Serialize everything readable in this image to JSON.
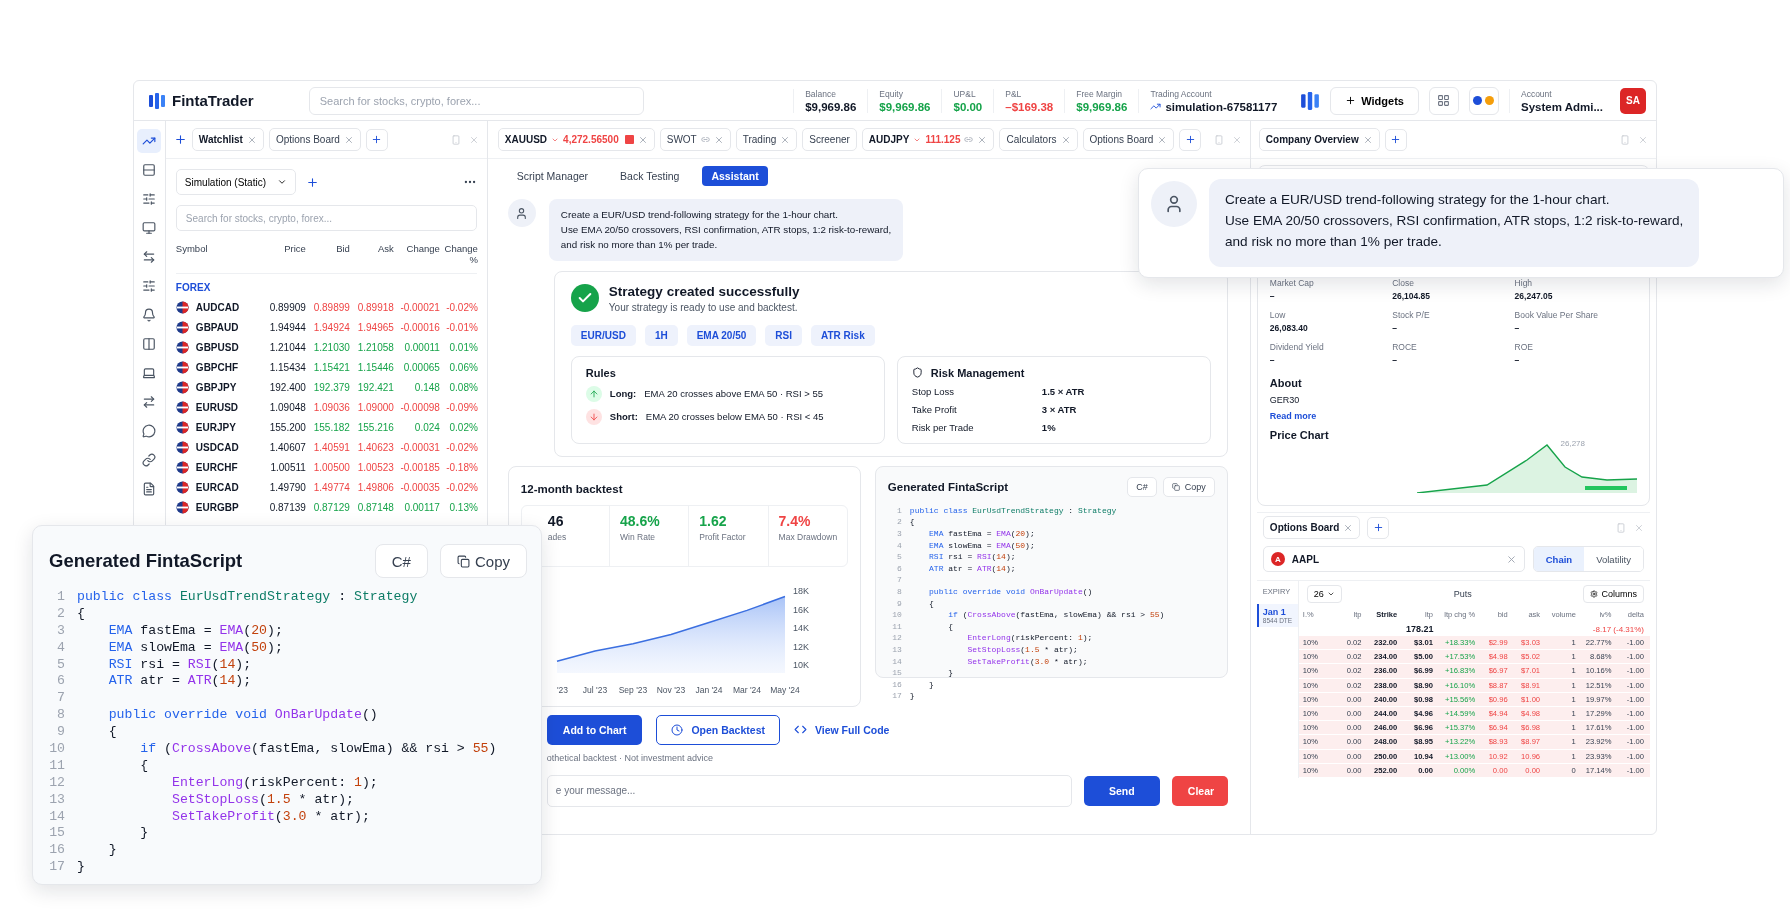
{
  "topbar": {
    "logo": "FintaTrader",
    "search": {
      "placeholder": "Search for stocks, crypto, forex..."
    },
    "stats": [
      {
        "label": "Balance",
        "value": "$9,969.86",
        "kind": "plain"
      },
      {
        "label": "Equity",
        "value": "$9,969.86",
        "kind": "gain"
      },
      {
        "label": "UP&L",
        "value": "$0.00",
        "kind": "gain"
      },
      {
        "label": "P&L",
        "value": "–$169.38",
        "kind": "loss"
      },
      {
        "label": "Free Margin",
        "value": "$9,969.86",
        "kind": "gain"
      }
    ],
    "account": {
      "label": "Trading Account",
      "value": "simulation-67581177"
    },
    "widgets_button": "Widgets",
    "user": {
      "label": "Account",
      "name": "System Admi...",
      "initials": "SA"
    }
  },
  "rail": [
    {
      "kind": "trend",
      "selected": true
    },
    {
      "kind": "rows",
      "selected": false
    },
    {
      "kind": "filters",
      "selected": false
    },
    {
      "kind": "monitor",
      "selected": false
    },
    {
      "kind": "transfer",
      "selected": false
    },
    {
      "kind": "sliders",
      "selected": false
    },
    {
      "kind": "bell",
      "selected": false
    },
    {
      "kind": "columns",
      "selected": false
    },
    {
      "kind": "laptop",
      "selected": false
    },
    {
      "kind": "swap",
      "selected": false
    },
    {
      "kind": "chat",
      "selected": false
    },
    {
      "kind": "link",
      "selected": false
    },
    {
      "kind": "document",
      "selected": false
    }
  ],
  "watchlist_panel": {
    "tabs": [
      {
        "label": "Watchlist",
        "selected": true
      },
      {
        "label": "Options Board",
        "selected": false
      }
    ],
    "list_select": "Simulation (Static)",
    "search": {
      "placeholder": "Search for stocks, crypto, forex..."
    },
    "columns": [
      "Symbol",
      "Price",
      "Bid",
      "Ask",
      "Change",
      "Change %"
    ],
    "group": "FOREX",
    "rows": [
      {
        "symbol": "AUDCAD",
        "price": "0.89909",
        "bid": "0.89899",
        "ask": "0.89918",
        "change": "-0.00021",
        "change_pct": "-0.02%",
        "up": false
      },
      {
        "symbol": "GBPAUD",
        "price": "1.94944",
        "bid": "1.94924",
        "ask": "1.94965",
        "change": "-0.00016",
        "change_pct": "-0.01%",
        "up": false
      },
      {
        "symbol": "GBPUSD",
        "price": "1.21044",
        "bid": "1.21030",
        "ask": "1.21058",
        "change": "0.00011",
        "change_pct": "0.01%",
        "up": true
      },
      {
        "symbol": "GBPCHF",
        "price": "1.15434",
        "bid": "1.15421",
        "ask": "1.15446",
        "change": "0.00065",
        "change_pct": "0.06%",
        "up": true
      },
      {
        "symbol": "GBPJPY",
        "price": "192.400",
        "bid": "192.379",
        "ask": "192.421",
        "change": "0.148",
        "change_pct": "0.08%",
        "up": true
      },
      {
        "symbol": "EURUSD",
        "price": "1.09048",
        "bid": "1.09036",
        "ask": "1.09000",
        "change": "-0.00098",
        "change_pct": "-0.09%",
        "up": false
      },
      {
        "symbol": "EURJPY",
        "price": "155.200",
        "bid": "155.182",
        "ask": "155.216",
        "change": "0.024",
        "change_pct": "0.02%",
        "up": true
      },
      {
        "symbol": "USDCAD",
        "price": "1.40607",
        "bid": "1.40591",
        "ask": "1.40623",
        "change": "-0.00031",
        "change_pct": "-0.02%",
        "up": false
      },
      {
        "symbol": "EURCHF",
        "price": "1.00511",
        "bid": "1.00500",
        "ask": "1.00523",
        "change": "-0.00185",
        "change_pct": "-0.18%",
        "up": false
      },
      {
        "symbol": "EURCAD",
        "price": "1.49790",
        "bid": "1.49774",
        "ask": "1.49806",
        "change": "-0.00035",
        "change_pct": "-0.02%",
        "up": false
      },
      {
        "symbol": "EURGBP",
        "price": "0.87139",
        "bid": "0.87129",
        "ask": "0.87148",
        "change": "0.00117",
        "change_pct": "0.13%",
        "up": true
      }
    ]
  },
  "workspace": {
    "tabs": [
      {
        "kind": "symbol",
        "label": "XAUUSD",
        "price": "4,272.56500",
        "closable": true
      },
      {
        "kind": "linked",
        "label": "SWOT",
        "closable": true
      },
      {
        "kind": "widget",
        "label": "Trading",
        "closable": true
      },
      {
        "kind": "widget",
        "label": "Screener",
        "closable": false
      },
      {
        "kind": "linkedsymbol",
        "label": "AUDJPY",
        "price": "111.125",
        "closable": true
      },
      {
        "kind": "widget",
        "label": "Calculators",
        "closable": true
      },
      {
        "kind": "widget",
        "label": "Options Board",
        "closable": true
      }
    ],
    "subtabs": [
      {
        "label": "Script Manager",
        "selected": false
      },
      {
        "label": "Back Testing",
        "selected": false
      },
      {
        "label": "Assistant",
        "selected": true
      }
    ],
    "message_lines": [
      "Create a EUR/USD trend-following strategy for the 1-hour chart.",
      "Use EMA 20/50 crossovers, RSI confirmation, ATR stops, 1:2 risk-to-reward,",
      "and risk no more than 1% per trade."
    ],
    "result": {
      "title": "Strategy created successfully",
      "subtitle": "Your strategy is ready to use and backtest.",
      "tags": [
        "EUR/USD",
        "1H",
        "EMA 20/50",
        "RSI",
        "ATR Risk"
      ],
      "rules_title": "Rules",
      "rules": [
        {
          "kind": "long",
          "label": "Long:",
          "text": "EMA 20 crosses above EMA 50 · RSI > 55"
        },
        {
          "kind": "short",
          "label": "Short:",
          "text": "EMA 20 crosses below EMA 50 · RSI < 45"
        }
      ],
      "risk_title": "Risk Management",
      "risk": [
        {
          "label": "Stop Loss",
          "value": "1.5 × ATR"
        },
        {
          "label": "Take Profit",
          "value": "3 × ATR"
        },
        {
          "label": "Risk per Trade",
          "value": "1%"
        }
      ]
    },
    "backtest": {
      "title": "12-month backtest",
      "stats": [
        {
          "value": "46",
          "label": "ades",
          "kind": "plain"
        },
        {
          "value": "48.6%",
          "label": "Win Rate",
          "kind": "gain"
        },
        {
          "value": "1.62",
          "label": "Profit Factor",
          "kind": "gain"
        },
        {
          "value": "7.4%",
          "label": "Max Drawdown",
          "kind": "loss"
        }
      ],
      "chart_data": {
        "type": "area",
        "categories": [
          "'23",
          "Jul '23",
          "Sep '23",
          "Nov '23",
          "Jan '24",
          "Mar '24",
          "May '24"
        ],
        "values": [
          10400,
          11500,
          12300,
          13300,
          14600,
          15900,
          17400
        ],
        "ylim": [
          10000,
          18000
        ],
        "yticks": [
          {
            "value": 10000,
            "label": "10K"
          },
          {
            "value": 12000,
            "label": "12K"
          },
          {
            "value": 14000,
            "label": "14K"
          },
          {
            "value": 16000,
            "label": "16K"
          },
          {
            "value": 18000,
            "label": "18K"
          }
        ]
      }
    },
    "script": {
      "title": "Generated FintaScript",
      "lang": "C#",
      "copy": "Copy",
      "lines": [
        {
          "n": "1",
          "t": [
            {
              "kind": "kw",
              "text": "public class "
            },
            {
              "kind": "type",
              "text": "EurUsdTrendStrategy"
            },
            {
              "kind": "p",
              "text": " : "
            },
            {
              "kind": "type",
              "text": "Strategy"
            }
          ]
        },
        {
          "n": "2",
          "t": [
            {
              "kind": "p",
              "text": "{"
            }
          ]
        },
        {
          "n": "3",
          "t": [
            {
              "kind": "kw",
              "text": "    EMA"
            },
            {
              "kind": "p",
              "text": " fastEma = "
            },
            {
              "kind": "fn",
              "text": "EMA"
            },
            {
              "kind": "p",
              "text": "("
            },
            {
              "kind": "num",
              "text": "20"
            },
            {
              "kind": "p",
              "text": ");"
            }
          ]
        },
        {
          "n": "4",
          "t": [
            {
              "kind": "kw",
              "text": "    EMA"
            },
            {
              "kind": "p",
              "text": " slowEma = "
            },
            {
              "kind": "fn",
              "text": "EMA"
            },
            {
              "kind": "p",
              "text": "("
            },
            {
              "kind": "num",
              "text": "50"
            },
            {
              "kind": "p",
              "text": ");"
            }
          ]
        },
        {
          "n": "5",
          "t": [
            {
              "kind": "kw",
              "text": "    RSI"
            },
            {
              "kind": "p",
              "text": " rsi = "
            },
            {
              "kind": "fn",
              "text": "RSI"
            },
            {
              "kind": "p",
              "text": "("
            },
            {
              "kind": "num",
              "text": "14"
            },
            {
              "kind": "p",
              "text": ");"
            }
          ]
        },
        {
          "n": "6",
          "t": [
            {
              "kind": "kw",
              "text": "    ATR"
            },
            {
              "kind": "p",
              "text": " atr = "
            },
            {
              "kind": "fn",
              "text": "ATR"
            },
            {
              "kind": "p",
              "text": "("
            },
            {
              "kind": "num",
              "text": "14"
            },
            {
              "kind": "p",
              "text": ");"
            }
          ]
        },
        {
          "n": "7"
        },
        {
          "n": "8",
          "t": [
            {
              "kind": "kw",
              "text": "    public override void "
            },
            {
              "kind": "fn",
              "text": "OnBarUpdate"
            },
            {
              "kind": "p",
              "text": "()"
            }
          ]
        },
        {
          "n": "9",
          "t": [
            {
              "kind": "p",
              "text": "    {"
            }
          ]
        },
        {
          "n": "10",
          "t": [
            {
              "kind": "kw",
              "text": "        if"
            },
            {
              "kind": "p",
              "text": " ("
            },
            {
              "kind": "fn",
              "text": "CrossAbove"
            },
            {
              "kind": "p",
              "text": "(fastEma, slowEma) && rsi > "
            },
            {
              "kind": "num",
              "text": "55"
            },
            {
              "kind": "p",
              "text": ")"
            }
          ]
        },
        {
          "n": "11",
          "t": [
            {
              "kind": "p",
              "text": "        {"
            }
          ]
        },
        {
          "n": "12",
          "t": [
            {
              "kind": "fn",
              "text": "            EnterLong"
            },
            {
              "kind": "p",
              "text": "(riskPercent: "
            },
            {
              "kind": "num",
              "text": "1"
            },
            {
              "kind": "p",
              "text": ");"
            }
          ]
        },
        {
          "n": "13",
          "t": [
            {
              "kind": "fn",
              "text": "            SetStopLoss"
            },
            {
              "kind": "p",
              "text": "("
            },
            {
              "kind": "num",
              "text": "1.5"
            },
            {
              "kind": "p",
              "text": " * atr);"
            }
          ]
        },
        {
          "n": "14",
          "t": [
            {
              "kind": "fn",
              "text": "            SetTakeProfit"
            },
            {
              "kind": "p",
              "text": "("
            },
            {
              "kind": "num",
              "text": "3.0"
            },
            {
              "kind": "p",
              "text": " * atr);"
            }
          ]
        },
        {
          "n": "15",
          "t": [
            {
              "kind": "p",
              "text": "        }"
            }
          ]
        },
        {
          "n": "16",
          "t": [
            {
              "kind": "p",
              "text": "    }"
            }
          ]
        },
        {
          "n": "17",
          "t": [
            {
              "kind": "p",
              "text": "}"
            }
          ]
        }
      ]
    },
    "actions": {
      "add": "Add to Chart",
      "open": "Open Backtest",
      "code": "View Full Code"
    },
    "disclaimer": "othetical backtest · Not investment advice",
    "composer": {
      "placeholder": "e your message...",
      "send": "Send",
      "clear": "Clear"
    }
  },
  "overview": {
    "tabs": [
      {
        "label": "Company Overview",
        "selected": true
      }
    ],
    "stats": [
      {
        "label": "Market Cap",
        "value": "–"
      },
      {
        "label": "Close",
        "value": "26,104.85"
      },
      {
        "label": "High",
        "value": "26,247.05"
      },
      {
        "label": "Low",
        "value": "26,083.40"
      },
      {
        "label": "Stock P/E",
        "value": "–"
      },
      {
        "label": "Book Value Per Share",
        "value": "–"
      },
      {
        "label": "Dividend Yield",
        "value": "–"
      },
      {
        "label": "ROCE",
        "value": "–"
      },
      {
        "label": "ROE",
        "value": "–"
      }
    ],
    "about_title": "About",
    "about_text": "GER30",
    "read_more": "Read more",
    "chart_title": "Price Chart",
    "chart_label": "26,278"
  },
  "options": {
    "tabs": [
      {
        "label": "Options Board",
        "selected": true
      }
    ],
    "symbol_badge": "A",
    "symbol": "AAPL",
    "views": [
      {
        "label": "Chain",
        "selected": true
      },
      {
        "label": "Volatility",
        "selected": false
      }
    ],
    "expiry_label": "EXPIRY",
    "expiries": [
      {
        "date": "Jan 1",
        "dte": "8544 DTE",
        "selected": true
      }
    ],
    "count_select": "26",
    "side": "Puts",
    "columns_button": "Columns",
    "columns": [
      "I.%",
      "ltp",
      "Strike",
      "ltp",
      "ltp chg %",
      "bid",
      "ask",
      "volume",
      "iv%",
      "delta"
    ],
    "spot": "178.21",
    "spot_change": "-8.17 (-4.31%)",
    "rows": [
      [
        "10%",
        "0.02",
        "232.00",
        "$3.01",
        "+18.33%",
        "$2.99",
        "$3.03",
        "1",
        "22.77%",
        "-1.00"
      ],
      [
        "10%",
        "0.02",
        "234.00",
        "$5.00",
        "+17.53%",
        "$4.98",
        "$5.02",
        "1",
        "8.68%",
        "-1.00"
      ],
      [
        "10%",
        "0.02",
        "236.00",
        "$6.99",
        "+16.83%",
        "$6.97",
        "$7.01",
        "1",
        "10.16%",
        "-1.00"
      ],
      [
        "10%",
        "0.02",
        "238.00",
        "$8.90",
        "+16.10%",
        "$8.87",
        "$8.91",
        "1",
        "12.51%",
        "-1.00"
      ],
      [
        "10%",
        "0.00",
        "240.00",
        "$0.98",
        "+15.56%",
        "$0.96",
        "$1.00",
        "1",
        "19.97%",
        "-1.00"
      ],
      [
        "10%",
        "0.00",
        "244.00",
        "$4.96",
        "+14.59%",
        "$4.94",
        "$4.98",
        "1",
        "17.29%",
        "-1.00"
      ],
      [
        "10%",
        "0.00",
        "246.00",
        "$6.96",
        "+15.37%",
        "$6.94",
        "$6.98",
        "1",
        "17.61%",
        "-1.00"
      ],
      [
        "10%",
        "0.00",
        "248.00",
        "$8.95",
        "+13.22%",
        "$8.93",
        "$8.97",
        "1",
        "23.92%",
        "-1.00"
      ],
      [
        "10%",
        "0.00",
        "250.00",
        "10.94",
        "+13.00%",
        "10.92",
        "10.96",
        "1",
        "23.93%",
        "-1.00"
      ],
      [
        "10%",
        "0.00",
        "252.00",
        "0.00",
        "0.00%",
        "0.00",
        "0.00",
        "0",
        "17.14%",
        "-1.00"
      ]
    ]
  },
  "prompt_popup": {
    "lines": [
      "Create a EUR/USD trend-following strategy for the 1-hour chart.",
      "Use EMA 20/50 crossovers, RSI confirmation, ATR stops, 1:2 risk-to-reward,",
      "and risk no more than 1% per trade."
    ]
  },
  "script_popup": {
    "title": "Generated FintaScript",
    "lang": "C#",
    "copy": "Copy",
    "lines": [
      {
        "n": "1",
        "t": [
          {
            "kind": "kw",
            "text": "public class "
          },
          {
            "kind": "type",
            "text": "EurUsdTrendStrategy"
          },
          {
            "kind": "p",
            "text": " : "
          },
          {
            "kind": "type",
            "text": "Strategy"
          }
        ]
      },
      {
        "n": "2",
        "t": [
          {
            "kind": "p",
            "text": "{"
          }
        ]
      },
      {
        "n": "3",
        "t": [
          {
            "kind": "kw",
            "text": "    EMA"
          },
          {
            "kind": "p",
            "text": " fastEma = "
          },
          {
            "kind": "fn",
            "text": "EMA"
          },
          {
            "kind": "p",
            "text": "("
          },
          {
            "kind": "num",
            "text": "20"
          },
          {
            "kind": "p",
            "text": ");"
          }
        ]
      },
      {
        "n": "4",
        "t": [
          {
            "kind": "kw",
            "text": "    EMA"
          },
          {
            "kind": "p",
            "text": " slowEma = "
          },
          {
            "kind": "fn",
            "text": "EMA"
          },
          {
            "kind": "p",
            "text": "("
          },
          {
            "kind": "num",
            "text": "50"
          },
          {
            "kind": "p",
            "text": ");"
          }
        ]
      },
      {
        "n": "5",
        "t": [
          {
            "kind": "kw",
            "text": "    RSI"
          },
          {
            "kind": "p",
            "text": " rsi = "
          },
          {
            "kind": "fn",
            "text": "RSI"
          },
          {
            "kind": "p",
            "text": "("
          },
          {
            "kind": "num",
            "text": "14"
          },
          {
            "kind": "p",
            "text": ");"
          }
        ]
      },
      {
        "n": "6",
        "t": [
          {
            "kind": "kw",
            "text": "    ATR"
          },
          {
            "kind": "p",
            "text": " atr = "
          },
          {
            "kind": "fn",
            "text": "ATR"
          },
          {
            "kind": "p",
            "text": "("
          },
          {
            "kind": "num",
            "text": "14"
          },
          {
            "kind": "p",
            "text": ");"
          }
        ]
      },
      {
        "n": "7"
      },
      {
        "n": "8",
        "t": [
          {
            "kind": "kw",
            "text": "    public override void "
          },
          {
            "kind": "fn",
            "text": "OnBarUpdate"
          },
          {
            "kind": "p",
            "text": "()"
          }
        ]
      },
      {
        "n": "9",
        "t": [
          {
            "kind": "p",
            "text": "    {"
          }
        ]
      },
      {
        "n": "10",
        "t": [
          {
            "kind": "kw",
            "text": "        if"
          },
          {
            "kind": "p",
            "text": " ("
          },
          {
            "kind": "fn",
            "text": "CrossAbove"
          },
          {
            "kind": "p",
            "text": "(fastEma, slowEma) && rsi > "
          },
          {
            "kind": "num",
            "text": "55"
          },
          {
            "kind": "p",
            "text": ")"
          }
        ]
      },
      {
        "n": "11",
        "t": [
          {
            "kind": "p",
            "text": "        {"
          }
        ]
      },
      {
        "n": "12",
        "t": [
          {
            "kind": "fn",
            "text": "            EnterLong"
          },
          {
            "kind": "p",
            "text": "(riskPercent: "
          },
          {
            "kind": "num",
            "text": "1"
          },
          {
            "kind": "p",
            "text": ");"
          }
        ]
      },
      {
        "n": "13",
        "t": [
          {
            "kind": "fn",
            "text": "            SetStopLoss"
          },
          {
            "kind": "p",
            "text": "("
          },
          {
            "kind": "num",
            "text": "1.5"
          },
          {
            "kind": "p",
            "text": " * atr);"
          }
        ]
      },
      {
        "n": "14",
        "t": [
          {
            "kind": "fn",
            "text": "            SetTakeProfit"
          },
          {
            "kind": "p",
            "text": "("
          },
          {
            "kind": "num",
            "text": "3.0"
          },
          {
            "kind": "p",
            "text": " * atr);"
          }
        ]
      },
      {
        "n": "15",
        "t": [
          {
            "kind": "p",
            "text": "        }"
          }
        ]
      },
      {
        "n": "16",
        "t": [
          {
            "kind": "p",
            "text": "    }"
          }
        ]
      },
      {
        "n": "17",
        "t": [
          {
            "kind": "p",
            "text": "}"
          }
        ]
      }
    ]
  }
}
